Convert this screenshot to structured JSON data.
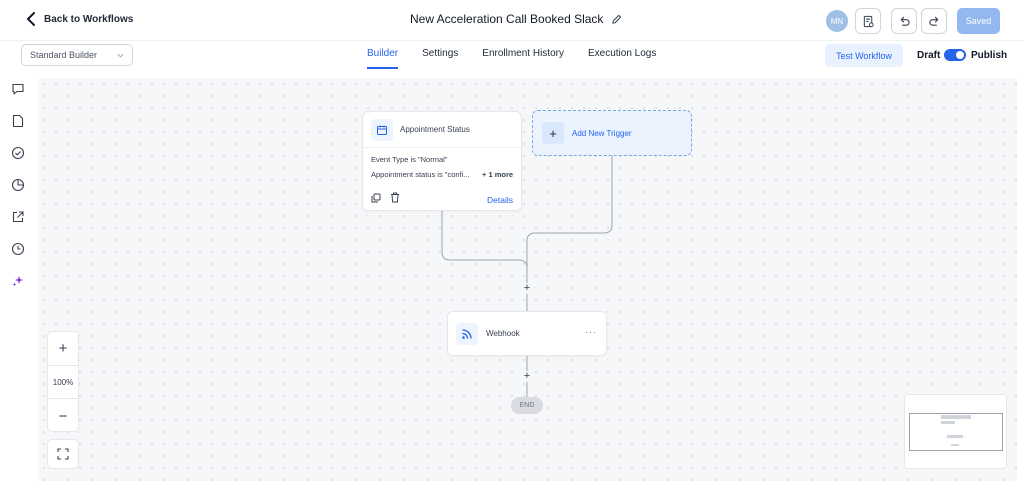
{
  "header": {
    "back_label": "Back to Workflows",
    "workflow_title": "New Acceleration Call Booked Slack",
    "avatar_initials": "MN",
    "saved_label": "Saved"
  },
  "subheader": {
    "builder_select": "Standard Builder",
    "tabs": [
      {
        "label": "Builder",
        "active": true
      },
      {
        "label": "Settings",
        "active": false
      },
      {
        "label": "Enrollment History",
        "active": false
      },
      {
        "label": "Execution Logs",
        "active": false
      }
    ],
    "test_workflow_label": "Test Workflow",
    "draft_label": "Draft",
    "publish_label": "Publish",
    "publish_toggle_on": true
  },
  "sidebar": {
    "icons": [
      "chat-icon",
      "note-icon",
      "check-circle-icon",
      "pie-chart-icon",
      "external-link-icon",
      "clock-icon",
      "sparkles-icon"
    ]
  },
  "canvas": {
    "trigger": {
      "title": "Appointment Status",
      "conditions": [
        "Event Type is \"Normal\"",
        "Appointment status is \"confi..."
      ],
      "more_label": "+ 1 more",
      "details_label": "Details"
    },
    "add_trigger_label": "Add New Trigger",
    "action": {
      "title": "Webhook",
      "menu": "···"
    },
    "plus_symbol": "+",
    "end_label": "END"
  },
  "controls": {
    "zoom_in": "+",
    "zoom_level": "100%",
    "zoom_out": "−"
  },
  "colors": {
    "accent": "#2563eb",
    "saved_button": "#93b8ef",
    "canvas_bg": "#f6f7f9"
  }
}
